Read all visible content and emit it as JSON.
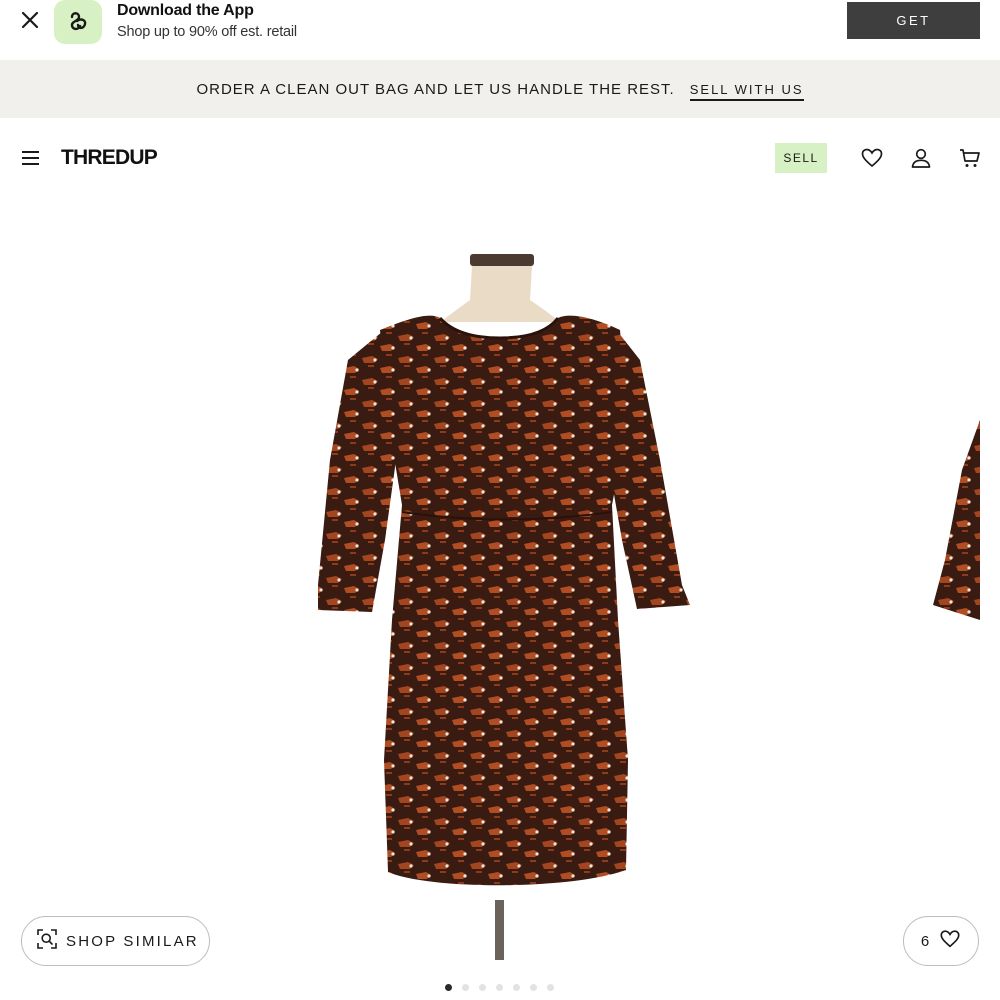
{
  "app_banner": {
    "title": "Download the App",
    "subtitle": "Shop up to 90% off est. retail",
    "get_label": "GET",
    "logo_bg": "#d7f0c4"
  },
  "promo": {
    "text": "ORDER A CLEAN OUT BAG AND LET US HANDLE THE REST.",
    "link_label": "SELL WITH US",
    "bg": "#f1f0ec"
  },
  "header": {
    "logo": "THREDUP",
    "sell_label": "SELL",
    "icons": [
      "menu-icon",
      "heart-icon",
      "user-icon",
      "cart-icon"
    ]
  },
  "product": {
    "shop_similar_label": "SHOP SIMILAR",
    "favorite_count": "6",
    "carousel": {
      "total": 7,
      "active": 1
    }
  }
}
